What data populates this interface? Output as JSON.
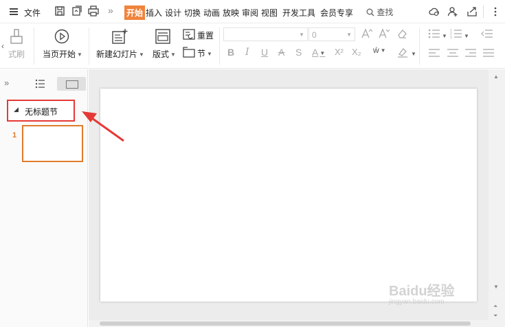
{
  "menubar": {
    "file_label": "文件",
    "more_glyph": "»",
    "tabs": [
      "开始",
      "插入",
      "设计",
      "切换",
      "动画",
      "放映",
      "审阅",
      "视图",
      "开发工具",
      "会员专享"
    ],
    "search_label": "查找",
    "active_tab_color": "#f0843c"
  },
  "ribbon": {
    "format_painter": "式刷",
    "from_current": "当页开始",
    "new_slide": "新建幻灯片",
    "layout": "版式",
    "reset": "重置",
    "section": "节",
    "font_size_value": "0"
  },
  "leftpane": {
    "collapse_glyph": "»",
    "section_title": "无标题节",
    "section_toggle": "◢",
    "slide_number": "1",
    "section_border_color": "#e53935",
    "thumb_border_color": "#e07b2a"
  },
  "watermark": {
    "main": "Baidu经验",
    "sub": "jingyan.baidu.com"
  }
}
